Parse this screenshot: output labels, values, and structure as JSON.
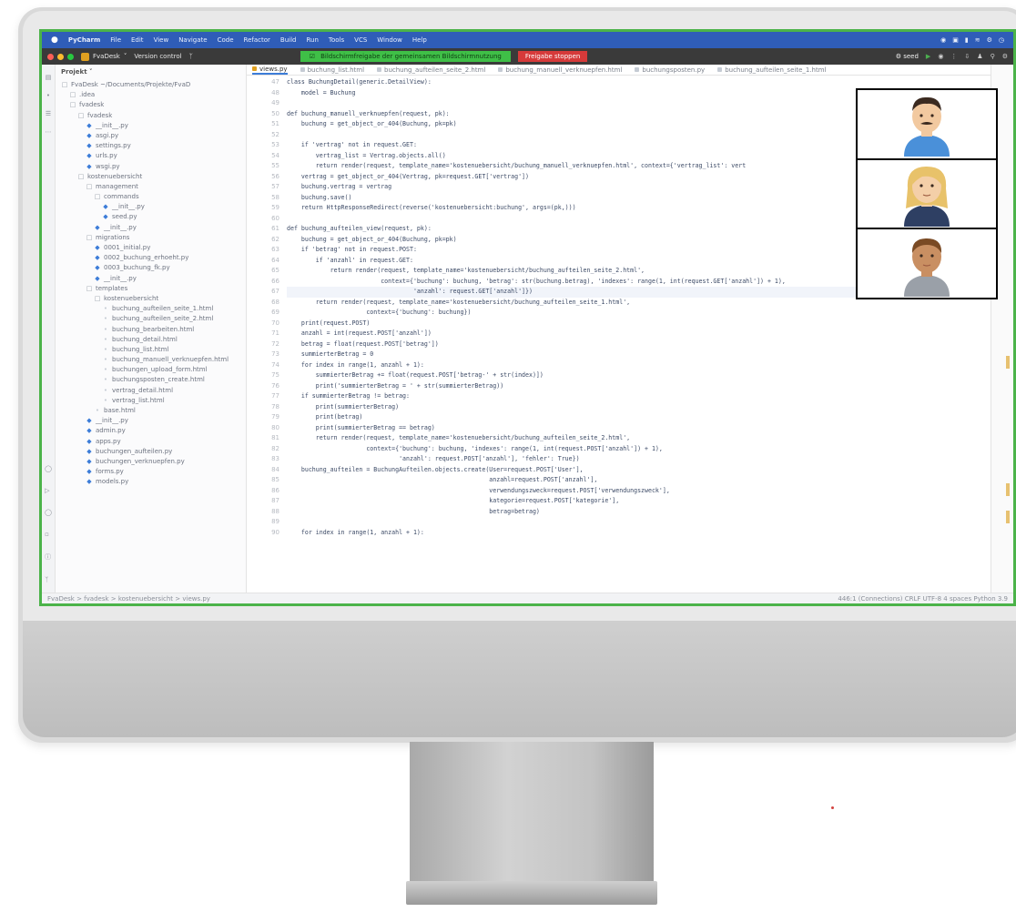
{
  "menu_bar": {
    "app_name": "PyCharm",
    "items": [
      "File",
      "Edit",
      "View",
      "Navigate",
      "Code",
      "Refactor",
      "Build",
      "Run",
      "Tools",
      "VCS",
      "Window",
      "Help"
    ]
  },
  "toolbar": {
    "project_name": "FvaDesk",
    "version_control": "Version control",
    "share_banner": "Bildschirmfreigabe der gemeinsamen Bildschirmnutzung",
    "stop_share": "Freigabe stoppen",
    "run_config": "seed"
  },
  "project_panel": {
    "title": "Projekt",
    "tree": [
      {
        "label": "FvaDesk  ~/Documents/Projekte/FvaD",
        "type": "dir",
        "indent": 0
      },
      {
        "label": ".idea",
        "type": "dir",
        "indent": 1
      },
      {
        "label": "fvadesk",
        "type": "dir",
        "indent": 1
      },
      {
        "label": "fvadesk",
        "type": "dir",
        "indent": 2
      },
      {
        "label": "__init__.py",
        "type": "py",
        "indent": 3
      },
      {
        "label": "asgi.py",
        "type": "py",
        "indent": 3
      },
      {
        "label": "settings.py",
        "type": "py",
        "indent": 3
      },
      {
        "label": "urls.py",
        "type": "py",
        "indent": 3
      },
      {
        "label": "wsgi.py",
        "type": "py",
        "indent": 3
      },
      {
        "label": "kostenuebersicht",
        "type": "dir",
        "indent": 2
      },
      {
        "label": "management",
        "type": "dir",
        "indent": 3
      },
      {
        "label": "commands",
        "type": "dir",
        "indent": 4
      },
      {
        "label": "__init__.py",
        "type": "py",
        "indent": 5
      },
      {
        "label": "seed.py",
        "type": "py",
        "indent": 5
      },
      {
        "label": "__init__.py",
        "type": "py",
        "indent": 4
      },
      {
        "label": "migrations",
        "type": "dir",
        "indent": 3
      },
      {
        "label": "0001_initial.py",
        "type": "py",
        "indent": 4
      },
      {
        "label": "0002_buchung_erhoeht.py",
        "type": "py",
        "indent": 4
      },
      {
        "label": "0003_buchung_fk.py",
        "type": "py",
        "indent": 4
      },
      {
        "label": "__init__.py",
        "type": "py",
        "indent": 4
      },
      {
        "label": "templates",
        "type": "dir",
        "indent": 3
      },
      {
        "label": "kostenuebersicht",
        "type": "dir",
        "indent": 4
      },
      {
        "label": "buchung_aufteilen_seite_1.html",
        "type": "html",
        "indent": 5
      },
      {
        "label": "buchung_aufteilen_seite_2.html",
        "type": "html",
        "indent": 5
      },
      {
        "label": "buchung_bearbeiten.html",
        "type": "html",
        "indent": 5
      },
      {
        "label": "buchung_detail.html",
        "type": "html",
        "indent": 5
      },
      {
        "label": "buchung_list.html",
        "type": "html",
        "indent": 5
      },
      {
        "label": "buchung_manuell_verknuepfen.html",
        "type": "html",
        "indent": 5
      },
      {
        "label": "buchungen_upload_form.html",
        "type": "html",
        "indent": 5
      },
      {
        "label": "buchungsposten_create.html",
        "type": "html",
        "indent": 5
      },
      {
        "label": "vertrag_detail.html",
        "type": "html",
        "indent": 5
      },
      {
        "label": "vertrag_list.html",
        "type": "html",
        "indent": 5
      },
      {
        "label": "base.html",
        "type": "html",
        "indent": 4
      },
      {
        "label": "__init__.py",
        "type": "py",
        "indent": 3
      },
      {
        "label": "admin.py",
        "type": "py",
        "indent": 3
      },
      {
        "label": "apps.py",
        "type": "py",
        "indent": 3
      },
      {
        "label": "buchungen_aufteilen.py",
        "type": "py",
        "indent": 3
      },
      {
        "label": "buchungen_verknuepfen.py",
        "type": "py",
        "indent": 3
      },
      {
        "label": "forms.py",
        "type": "py",
        "indent": 3
      },
      {
        "label": "models.py",
        "type": "py",
        "indent": 3
      }
    ]
  },
  "tabs": [
    {
      "label": "views.py",
      "active": true
    },
    {
      "label": "buchung_list.html",
      "active": false
    },
    {
      "label": "buchung_aufteilen_seite_2.html",
      "active": false
    },
    {
      "label": "buchung_manuell_verknuepfen.html",
      "active": false
    },
    {
      "label": "buchungsposten.py",
      "active": false
    },
    {
      "label": "buchung_aufteilen_seite_1.html",
      "active": false
    }
  ],
  "code": {
    "line_numbers": [
      "47",
      "48",
      "49",
      "50",
      "51",
      "52",
      "53",
      "54",
      "55",
      "56",
      "57",
      "58",
      "59",
      "60",
      "61",
      "62",
      "63",
      "64",
      "65",
      "66",
      "67",
      "68",
      "69",
      "70",
      "71",
      "72",
      "73",
      "74",
      "75",
      "76",
      "77",
      "78",
      "79",
      "80",
      "81",
      "82",
      "83",
      "84",
      "85",
      "86",
      "87",
      "88",
      "89",
      "90"
    ],
    "highlight_line": 20,
    "lines": [
      "class BuchungDetail(generic.DetailView):",
      "    model = Buchung",
      "",
      "def buchung_manuell_verknuepfen(request, pk):",
      "    buchung = get_object_or_404(Buchung, pk=pk)",
      "",
      "    if 'vertrag' not in request.GET:",
      "        vertrag_list = Vertrag.objects.all()",
      "        return render(request, template_name='kostenuebersicht/buchung_manuell_verknuepfen.html', context={'vertrag_list': vert",
      "    vertrag = get_object_or_404(Vertrag, pk=request.GET['vertrag'])",
      "    buchung.vertrag = vertrag",
      "    buchung.save()",
      "    return HttpResponseRedirect(reverse('kostenuebersicht:buchung', args=(pk,)))",
      "",
      "def buchung_aufteilen_view(request, pk):",
      "    buchung = get_object_or_404(Buchung, pk=pk)",
      "    if 'betrag' not in request.POST:",
      "        if 'anzahl' in request.GET:",
      "            return render(request, template_name='kostenuebersicht/buchung_aufteilen_seite_2.html',",
      "                          context={'buchung': buchung, 'betrag': str(buchung.betrag), 'indexes': range(1, int(request.GET['anzahl']) + 1),",
      "                                   'anzahl': request.GET['anzahl']})",
      "        return render(request, template_name='kostenuebersicht/buchung_aufteilen_seite_1.html',",
      "                      context={'buchung': buchung})",
      "    print(request.POST)",
      "    anzahl = int(request.POST['anzahl'])",
      "    betrag = float(request.POST['betrag'])",
      "    summierterBetrag = 0",
      "    for index in range(1, anzahl + 1):",
      "        summierterBetrag += float(request.POST['betrag-' + str(index)])",
      "        print('summierterBetrag = ' + str(summierterBetrag))",
      "    if summierterBetrag != betrag:",
      "        print(summierterBetrag)",
      "        print(betrag)",
      "        print(summierterBetrag == betrag)",
      "        return render(request, template_name='kostenuebersicht/buchung_aufteilen_seite_2.html',",
      "                      context={'buchung': buchung, 'indexes': range(1, int(request.POST['anzahl']) + 1),",
      "                               'anzahl': request.POST['anzahl'], 'fehler': True})",
      "    buchung_aufteilen = BuchungAufteilen.objects.create(User=request.POST['User'],",
      "                                                        anzahl=request.POST['anzahl'],",
      "                                                        verwendungszweck=request.POST['verwendungszweck'],",
      "                                                        kategorie=request.POST['kategorie'],",
      "                                                        betrag=betrag)",
      "",
      "    for index in range(1, anzahl + 1):"
    ]
  },
  "status_bar": {
    "breadcrumb": "FvaDesk > fvadesk > kostenuebersicht > views.py",
    "right": "446:1 (Connections)   CRLF   UTF-8   4 spaces   Python 3.9"
  },
  "participants": [
    {
      "name": "participant-man",
      "hair": "#3b2a20",
      "skin": "#f2c9a0",
      "shirt": "#4a90d9",
      "mustache": true
    },
    {
      "name": "participant-blonde-woman",
      "hair": "#e8c26a",
      "skin": "#f4cfa8",
      "shirt": "#2e3f63",
      "mustache": false
    },
    {
      "name": "participant-person",
      "hair": "#7a4a24",
      "skin": "#c98f62",
      "shirt": "#9aa0a8",
      "mustache": false
    }
  ]
}
